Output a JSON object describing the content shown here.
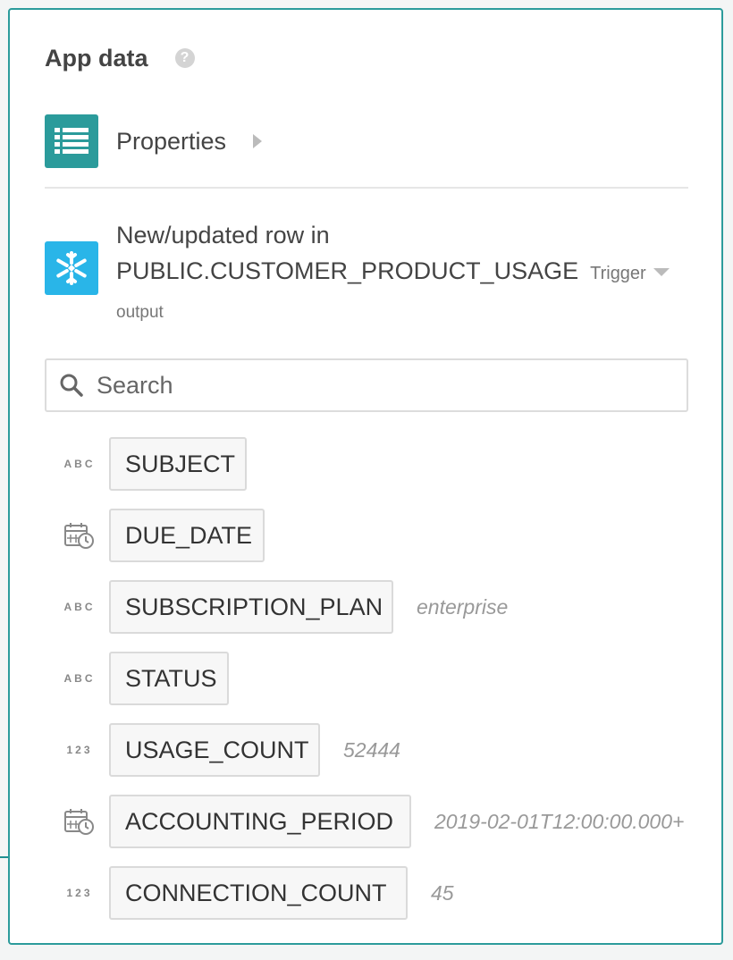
{
  "panel": {
    "title": "App data",
    "help_icon": "question-circle-icon"
  },
  "properties": {
    "label": "Properties",
    "icon": "list-icon",
    "icon_color": "#2b9b9b"
  },
  "trigger": {
    "title_line1": "New/updated row in",
    "title_line2": "PUBLIC.CUSTOMER_PRODUCT_USAGE",
    "badge": "Trigger",
    "subtitle": "output",
    "icon": "snowflake-icon",
    "icon_color": "#29b5e8"
  },
  "search": {
    "placeholder": "Search",
    "value": ""
  },
  "fields": [
    {
      "type": "ABC",
      "type_icon": "text-type-icon",
      "name": "SUBJECT",
      "sample": ""
    },
    {
      "type": "date",
      "type_icon": "calendar-clock-icon",
      "name": "DUE_DATE",
      "sample": ""
    },
    {
      "type": "ABC",
      "type_icon": "text-type-icon",
      "name": "SUBSCRIPTION_PLAN",
      "sample": "enterprise"
    },
    {
      "type": "ABC",
      "type_icon": "text-type-icon",
      "name": "STATUS",
      "sample": ""
    },
    {
      "type": "123",
      "type_icon": "number-type-icon",
      "name": "USAGE_COUNT",
      "sample": "52444"
    },
    {
      "type": "date",
      "type_icon": "calendar-clock-icon",
      "name": "ACCOUNTING_PERIOD",
      "sample": "2019-02-01T12:00:00.000+"
    },
    {
      "type": "123",
      "type_icon": "number-type-icon",
      "name": "CONNECTION_COUNT",
      "sample": "45"
    }
  ],
  "colors": {
    "accent": "#2b9b9b",
    "snowflake": "#29b5e8"
  }
}
